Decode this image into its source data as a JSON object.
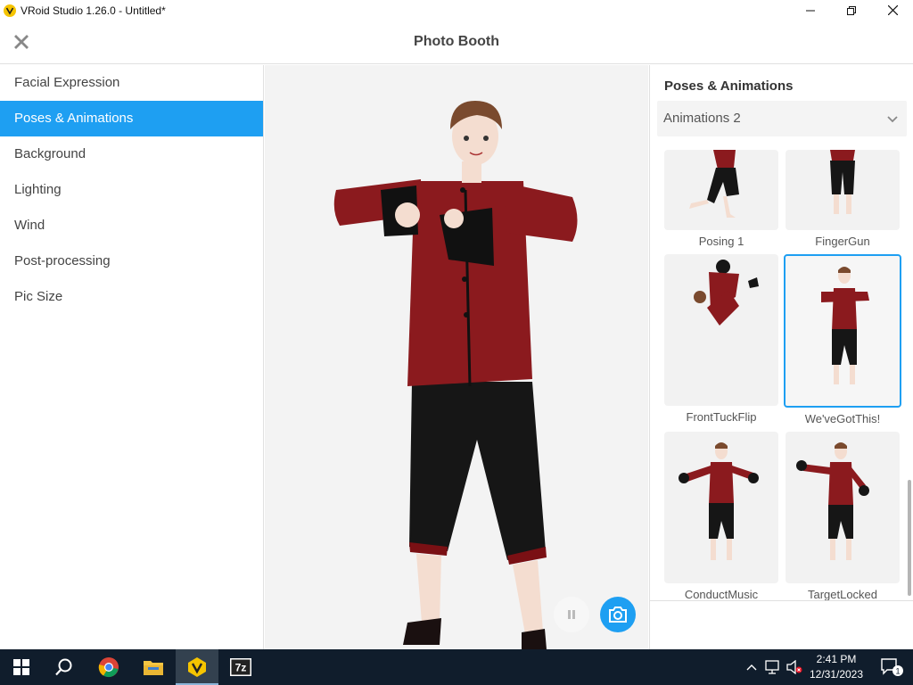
{
  "window": {
    "title": "VRoid Studio 1.26.0 - Untitled*",
    "minimize": "—",
    "maximize": "❐",
    "close": "✕"
  },
  "header": {
    "title": "Photo Booth"
  },
  "sidebar": {
    "items": [
      {
        "label": "Facial Expression",
        "active": false
      },
      {
        "label": "Poses & Animations",
        "active": true
      },
      {
        "label": "Background",
        "active": false
      },
      {
        "label": "Lighting",
        "active": false
      },
      {
        "label": "Wind",
        "active": false
      },
      {
        "label": "Post-processing",
        "active": false
      },
      {
        "label": "Pic Size",
        "active": false
      }
    ]
  },
  "right_panel": {
    "title": "Poses & Animations",
    "dropdown": {
      "selected": "Animations 2"
    },
    "cards": [
      {
        "label": "Posing 1",
        "selected": false
      },
      {
        "label": "FingerGun",
        "selected": false
      },
      {
        "label": "FrontTuckFlip",
        "selected": false
      },
      {
        "label": "We'veGotThis!",
        "selected": true
      },
      {
        "label": "ConductMusic",
        "selected": false
      },
      {
        "label": "TargetLocked",
        "selected": false
      }
    ]
  },
  "viewport": {
    "pause_icon": "pause-icon",
    "camera_icon": "camera-icon"
  },
  "taskbar": {
    "apps": [
      "windows-start",
      "search",
      "chrome",
      "file-explorer",
      "vroid-studio",
      "7zip"
    ],
    "active_app": "vroid-studio",
    "sevenzip_label": "7z",
    "time": "2:41 PM",
    "date": "12/31/2023",
    "notification_count": "1"
  },
  "colors": {
    "accent": "#1e9ff2",
    "taskbar": "#101d2c",
    "jacket": "#8b1a1e"
  }
}
